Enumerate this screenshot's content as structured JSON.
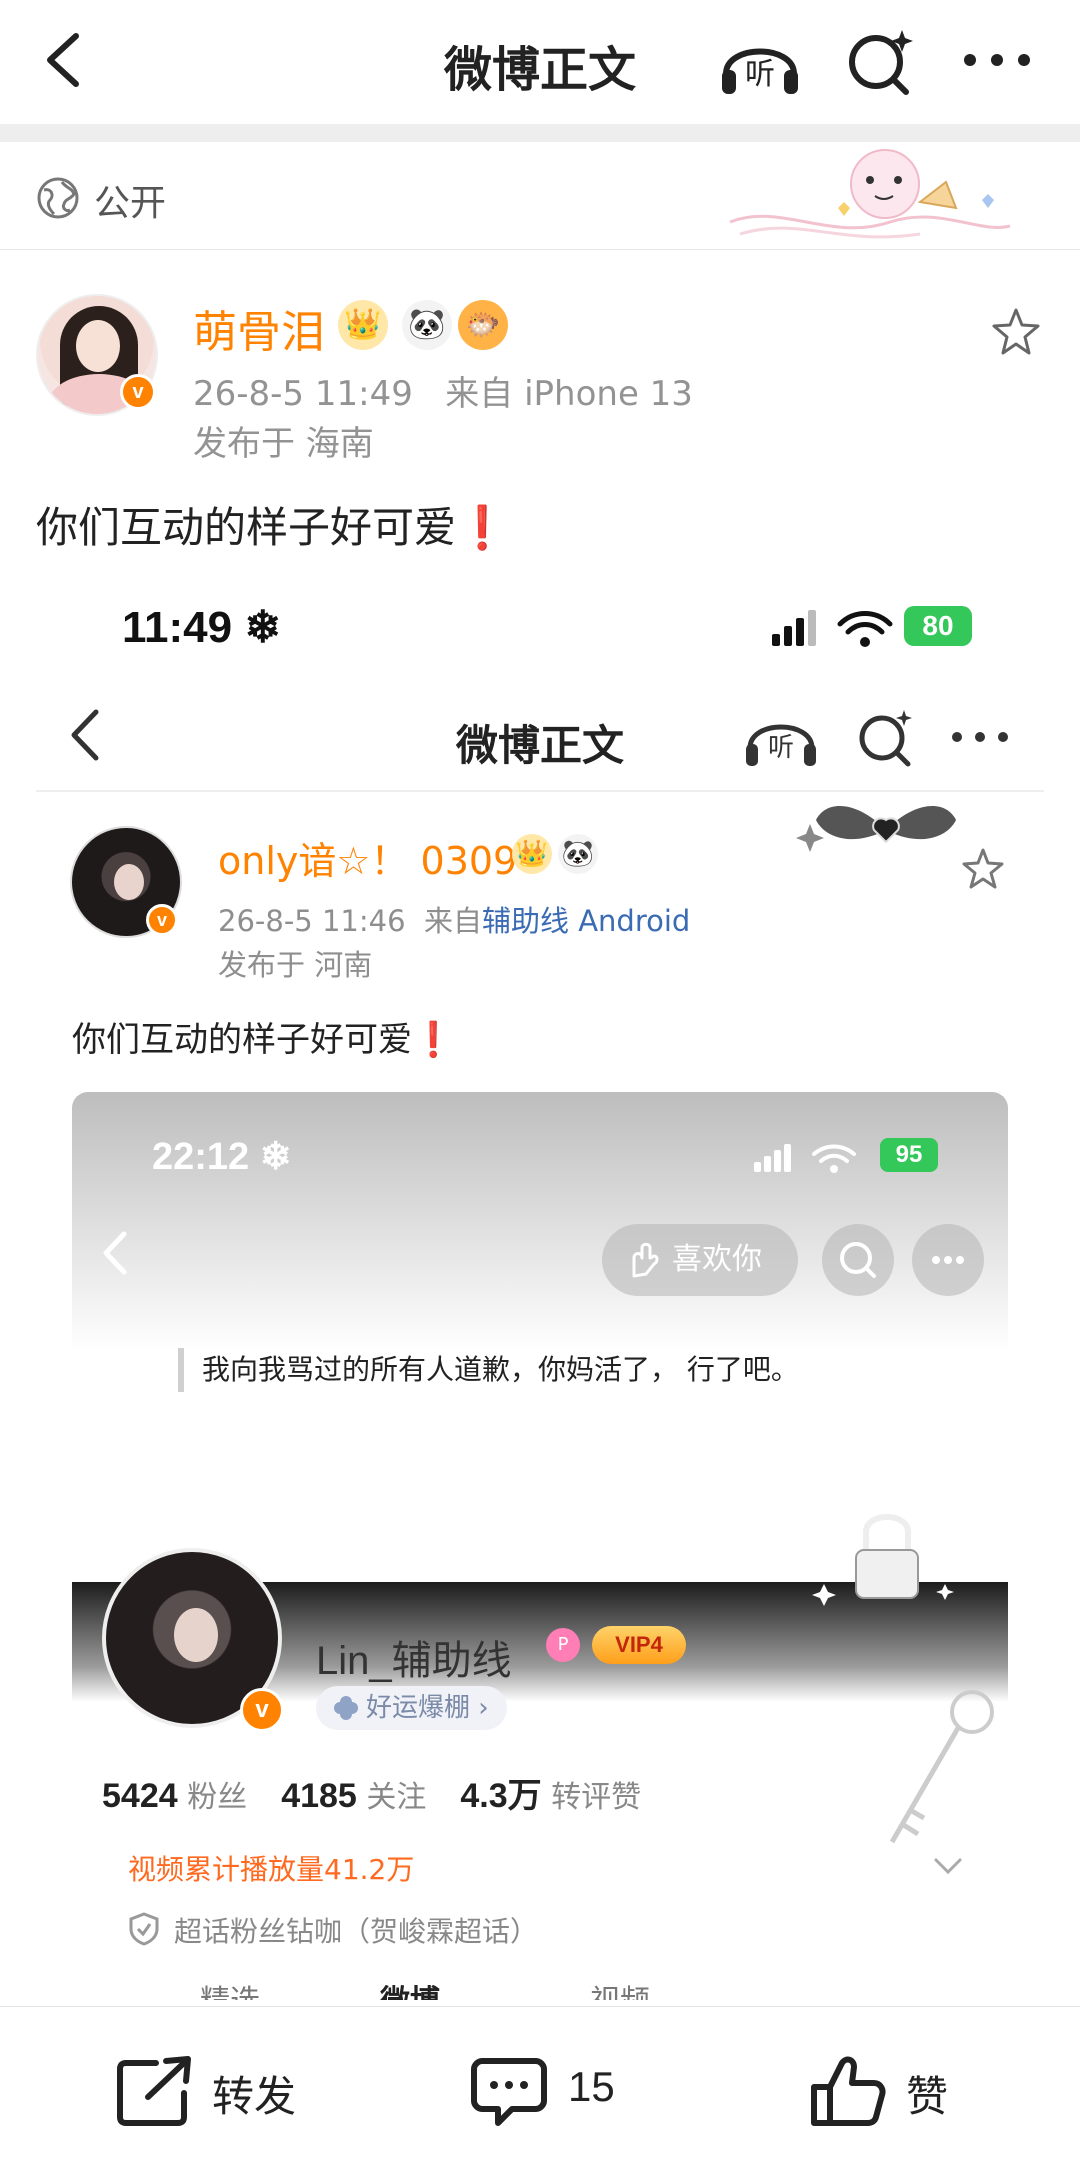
{
  "header": {
    "title": "微博正文",
    "back_icon": "chevron-left-icon",
    "listen_icon": "headphones-listen-icon",
    "listen_glyph": "听",
    "search_icon": "search-sparkle-icon",
    "more_icon": "more-dots-icon"
  },
  "visibility": {
    "label": "公开",
    "icon": "globe-icon"
  },
  "post": {
    "author": {
      "name": "萌骨泪",
      "verified_glyph": "v",
      "emojis": [
        "👑",
        "🐼",
        "🐡"
      ]
    },
    "time": "26-8-5 11:49",
    "source": "来自 iPhone 13",
    "location": "发布于 海南",
    "text": "你们互动的样子好可爱",
    "text_mark": "❗"
  },
  "screenshot": {
    "status": {
      "time": "11:49 ❄",
      "battery": "80"
    },
    "header": {
      "title": "微博正文",
      "listen_glyph": "听"
    },
    "author": {
      "name": "only谙☆！ 0309",
      "verified_glyph": "v",
      "emojis": [
        "👑",
        "🐼"
      ]
    },
    "time": "26-8-5 11:46",
    "source_prefix": "来自",
    "source_app": "辅助线 Android",
    "location": "发布于 河南",
    "text": "你们互动的样子好可爱",
    "text_mark": "❗",
    "inner": {
      "status": {
        "time": "22:12 ❄",
        "battery": "95"
      },
      "like_button": "喜欢你",
      "quote": "我向我骂过的所有人道歉，你妈活了，  行了吧。",
      "profile": {
        "name": "Lin_辅助线",
        "p_badge": "P",
        "vip": "VIP4",
        "verified_glyph": "v",
        "luck_tag": "好运爆棚 ›"
      },
      "stats": [
        {
          "value": "5424",
          "label": "粉丝"
        },
        {
          "value": "4185",
          "label": "关注"
        },
        {
          "value": "4.3万",
          "label": "转评赞"
        }
      ],
      "video_views": "视频累计播放量41.2万",
      "superfan": "超话粉丝钻咖（贺峻霖超话）",
      "tabs_peek": [
        "精选",
        "微博",
        "视频"
      ]
    }
  },
  "actions": {
    "repost": "转发",
    "comment_count": "15",
    "like": "赞"
  },
  "colors": {
    "accent_orange": "#ff8200",
    "meta_gray": "#939393",
    "source_blue": "#3b6bb3",
    "battery_green": "#34c759",
    "excl_red": "#e02020"
  }
}
